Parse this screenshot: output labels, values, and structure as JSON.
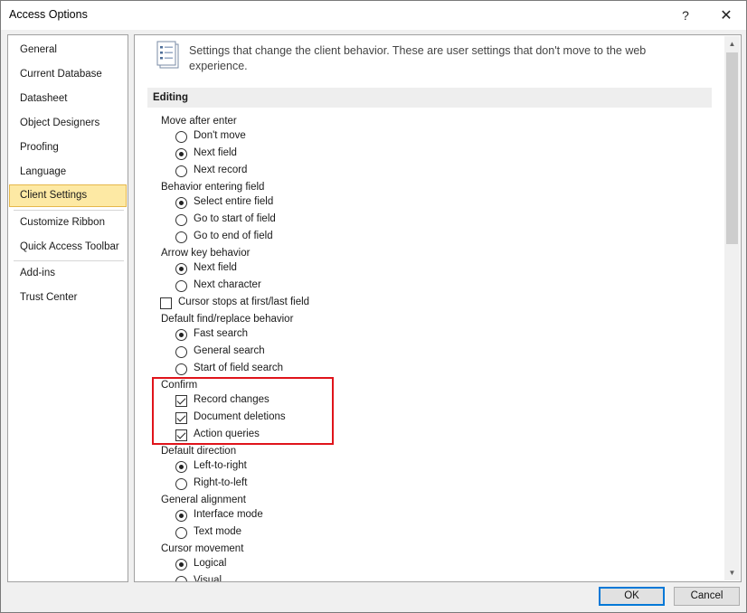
{
  "window": {
    "title": "Access Options",
    "help_glyph": "?",
    "close_glyph": "✕"
  },
  "sidebar": {
    "items": [
      {
        "label": "General"
      },
      {
        "label": "Current Database"
      },
      {
        "label": "Datasheet"
      },
      {
        "label": "Object Designers"
      },
      {
        "label": "Proofing"
      },
      {
        "label": "Language"
      },
      {
        "label": "Client Settings",
        "selected": true
      },
      {
        "label": "Customize Ribbon"
      },
      {
        "label": "Quick Access Toolbar"
      },
      {
        "label": "Add-ins"
      },
      {
        "label": "Trust Center"
      }
    ]
  },
  "content": {
    "header_icon": "settings-document-icon",
    "description": "Settings that change the client behavior. These are user settings that don't move to the web experience.",
    "section_title": "Editing",
    "groups": {
      "move_after_enter": {
        "label": "Move after enter",
        "options": [
          "Don't move",
          "Next field",
          "Next record"
        ],
        "selected": "Next field"
      },
      "behavior_entering_field": {
        "label": "Behavior entering field",
        "options": [
          "Select entire field",
          "Go to start of field",
          "Go to end of field"
        ],
        "selected": "Select entire field"
      },
      "arrow_key_behavior": {
        "label": "Arrow key behavior",
        "options": [
          "Next field",
          "Next character"
        ],
        "selected": "Next field"
      },
      "cursor_stops": {
        "label": "Cursor stops at first/last field",
        "checked": false
      },
      "default_find_replace": {
        "label": "Default find/replace behavior",
        "options": [
          "Fast search",
          "General search",
          "Start of field search"
        ],
        "selected": "Fast search"
      },
      "confirm": {
        "label": "Confirm",
        "items": [
          {
            "label": "Record changes",
            "checked": true
          },
          {
            "label": "Document deletions",
            "checked": true
          },
          {
            "label": "Action queries",
            "checked": true
          }
        ]
      },
      "default_direction": {
        "label": "Default direction",
        "options": [
          "Left-to-right",
          "Right-to-left"
        ],
        "selected": "Left-to-right"
      },
      "general_alignment": {
        "label": "General alignment",
        "options": [
          "Interface mode",
          "Text mode"
        ],
        "selected": "Interface mode"
      },
      "cursor_movement": {
        "label": "Cursor movement",
        "options": [
          "Logical",
          "Visual"
        ],
        "selected": "Logical"
      }
    },
    "highlight_color": "#e0141b"
  },
  "buttons": {
    "ok": "OK",
    "cancel": "Cancel"
  },
  "colors": {
    "selected_nav_bg": "#fde9a4",
    "selected_nav_border": "#e5b74a",
    "ok_border": "#0078d7"
  }
}
